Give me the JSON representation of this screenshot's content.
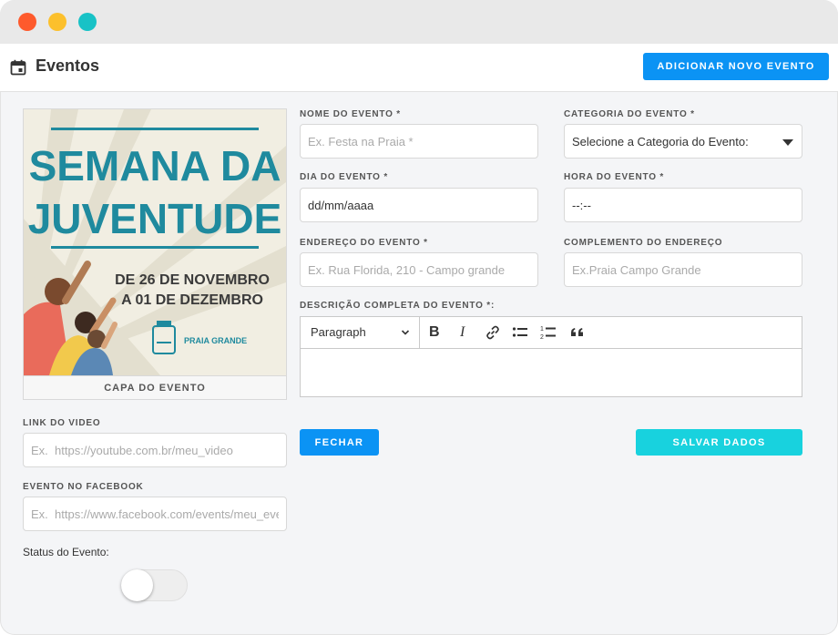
{
  "window": {
    "controls": [
      "close",
      "minimize",
      "zoom"
    ]
  },
  "header": {
    "title": "Eventos",
    "icon": "calendar-icon",
    "add_button": "ADICIONAR NOVO EVENTO"
  },
  "cover": {
    "caption": "CAPA DO EVENTO",
    "poster": {
      "line1": "SEMANA DA",
      "line2": "JUVENTUDE",
      "date1": "DE 26 DE NOVEMBRO",
      "date2": "A 01 DE DEZEMBRO",
      "brand": "PRAIA GRANDE"
    }
  },
  "form": {
    "nome": {
      "label": "NOME DO EVENTO *",
      "placeholder": "Ex. Festa na Praia *"
    },
    "categoria": {
      "label": "CATEGORIA DO EVENTO *",
      "value": "Selecione a Categoria do Evento:"
    },
    "dia": {
      "label": "DIA DO EVENTO *",
      "value": "dd/mm/aaaa"
    },
    "hora": {
      "label": "HORA DO EVENTO *",
      "value": "--:--"
    },
    "endereco": {
      "label": "ENDEREÇO DO EVENTO *",
      "placeholder": "Ex. Rua Florida, 210 - Campo grande"
    },
    "complemento": {
      "label": "COMPLEMENTO DO ENDEREÇO",
      "placeholder": "Ex.Praia Campo Grande"
    },
    "descricao": {
      "label": "DESCRIÇÃO COMPLETA DO EVENTO *:",
      "format": "Paragraph"
    },
    "video": {
      "label": "LINK DO VIDEO",
      "placeholder": "Ex.  https://youtube.com.br/meu_video"
    },
    "facebook": {
      "label": "EVENTO NO FACEBOOK",
      "placeholder": "Ex.  https://www.facebook.com/events/meu_evento"
    },
    "status": {
      "label": "Status do Evento:",
      "enabled": false
    }
  },
  "buttons": {
    "fechar": "FECHAR",
    "salvar": "SALVAR DADOS"
  },
  "colors": {
    "primary": "#0b93f4",
    "accent": "#18d2de",
    "poster_text": "#1f8a9e"
  }
}
